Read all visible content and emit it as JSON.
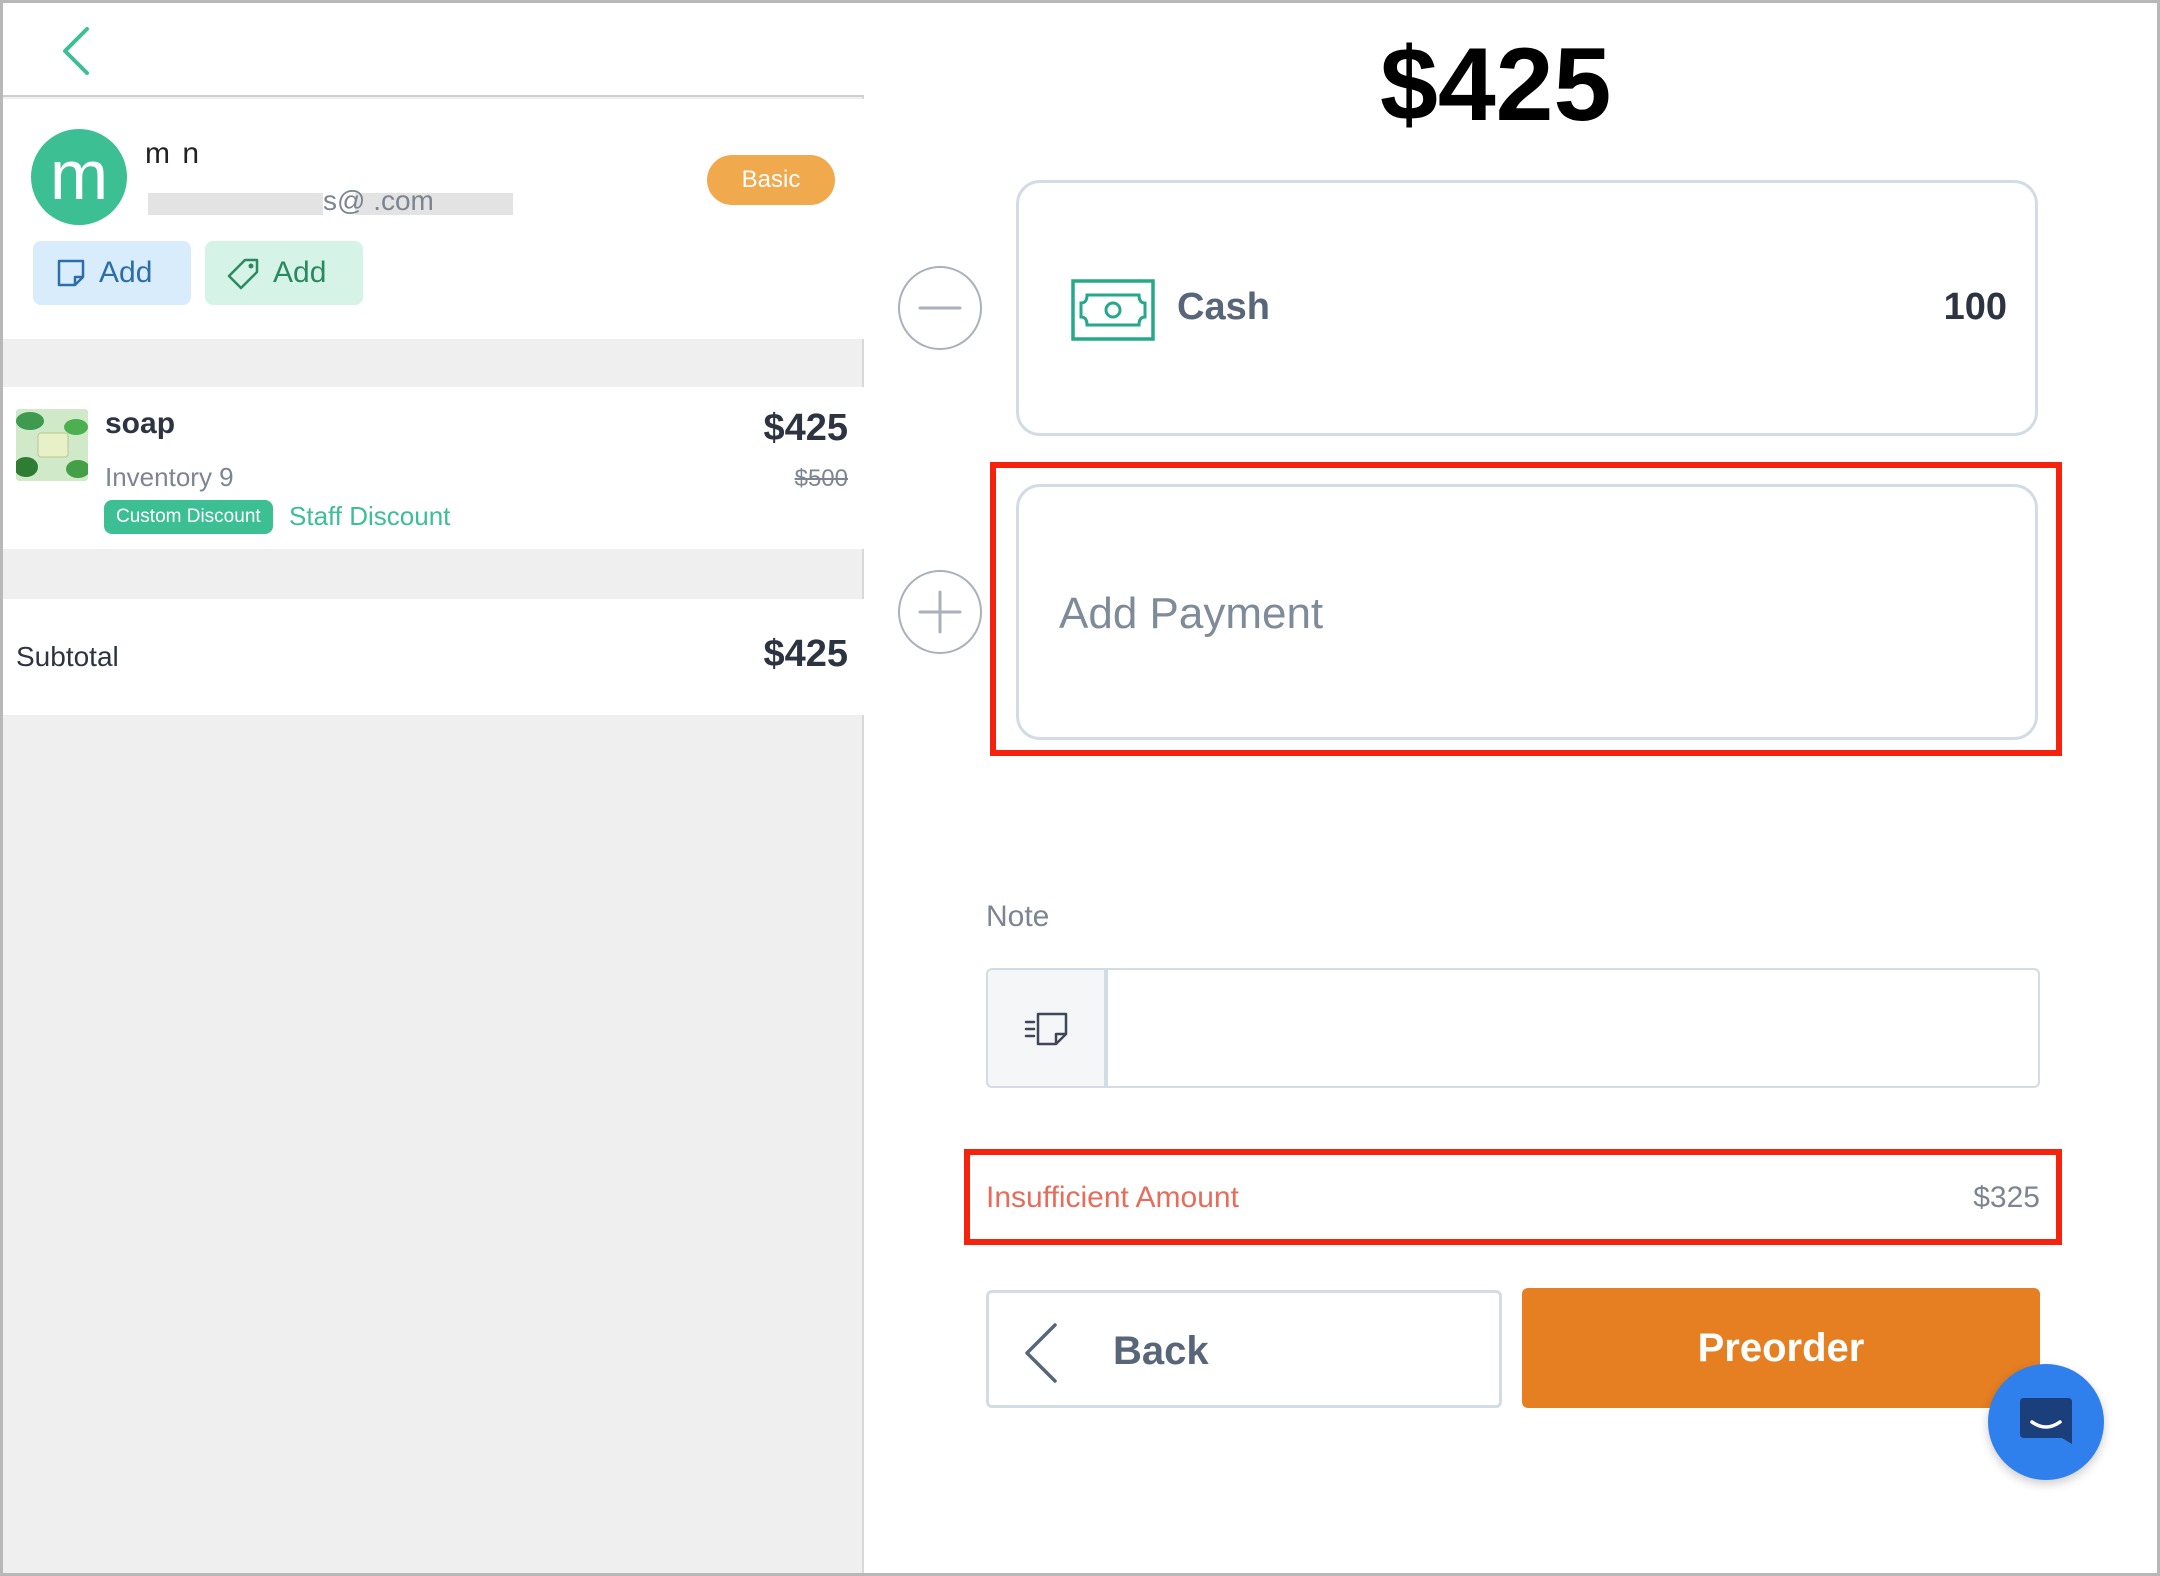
{
  "customer": {
    "initial": "m",
    "name": "m n",
    "email": "s@                .com",
    "tier": "Basic",
    "add_note_label": "Add",
    "add_tag_label": "Add"
  },
  "cart": {
    "items": [
      {
        "name": "soap",
        "inventory": "Inventory 9",
        "discount_badge": "Custom Discount",
        "discount_name": "Staff Discount",
        "price": "$425",
        "original_price": "$500"
      }
    ],
    "subtotal_label": "Subtotal",
    "subtotal_value": "$425"
  },
  "payment": {
    "total": "$425",
    "methods": [
      {
        "label": "Cash",
        "amount": "100",
        "icon": "cash-icon"
      }
    ],
    "add_payment_label": "Add Payment",
    "note_label": "Note",
    "note_value": "",
    "insufficient_label": "Insufficient Amount",
    "insufficient_amount": "$325",
    "back_label": "Back",
    "preorder_label": "Preorder"
  },
  "colors": {
    "accent_green": "#3cbf92",
    "tier_orange": "#f1a94d",
    "preorder_orange": "#e67e22",
    "error_red": "#e96b5a",
    "highlight_red": "#f5220d",
    "chat_blue": "#2f80ed"
  }
}
